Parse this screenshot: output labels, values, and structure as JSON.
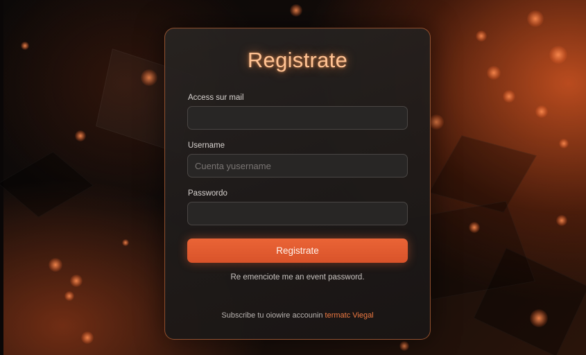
{
  "form": {
    "title": "Registrate",
    "email_label": "Access sur mail",
    "email_value": "",
    "email_placeholder": "",
    "username_label": "Username",
    "username_value": "",
    "username_placeholder": "Cuenta yusername",
    "password_label": "Passwordo",
    "password_value": "",
    "password_placeholder": "",
    "submit_label": "Registrate",
    "forgot_text": "Re emenciote me an event password.",
    "footer_text": "Subscribe tu oiowire accounin",
    "footer_link": "termatc Viegal"
  },
  "colors": {
    "accent": "#e85f33",
    "title_glow": "#ffc293",
    "link": "#f07a42",
    "card_border": "#eb783c"
  }
}
